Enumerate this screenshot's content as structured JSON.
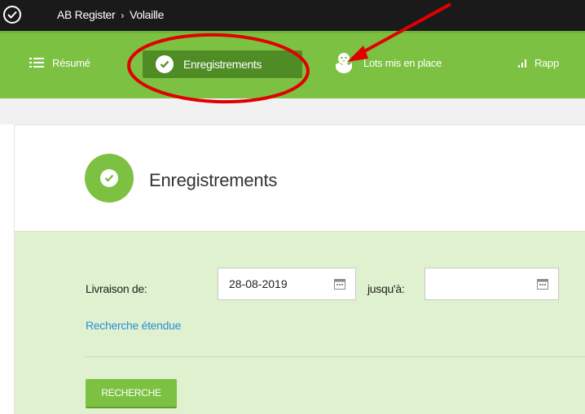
{
  "topbar": {
    "breadcrumb": [
      "AB Register",
      "Volaille"
    ],
    "separator": "›"
  },
  "nav": {
    "resume": "Résumé",
    "enregistrements": "Enregistrements",
    "lots": "Lots mis en place",
    "rapports": "Rapp"
  },
  "page": {
    "title": "Enregistrements"
  },
  "form": {
    "livraison_label": "Livraison de:",
    "livraison_value": "28-08-2019",
    "jusqua_label": "jusqu'à:",
    "jusqua_value": "",
    "extended_search": "Recherche étendue",
    "search_button": "RECHERCHE"
  },
  "colors": {
    "accent": "#7cc142",
    "active": "#4f8c26",
    "topbar": "#1a1a1a",
    "annotation": "#e00000",
    "link": "#2b8fd6"
  }
}
